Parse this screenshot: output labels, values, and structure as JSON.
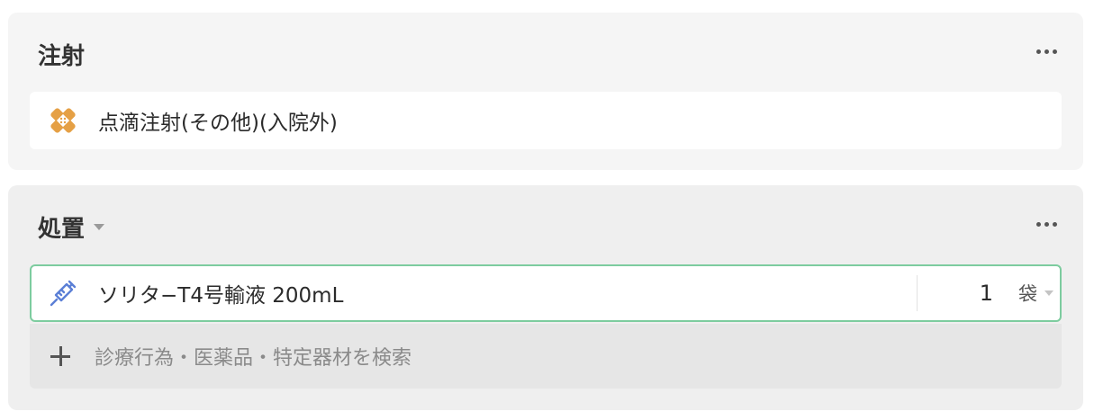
{
  "injection": {
    "title": "注射",
    "more_icon": "more-horizontal-icon",
    "item": {
      "icon": "bandage-cross-icon",
      "label": "点滴注射(その他)(入院外)",
      "icon_color": "#e5a045"
    }
  },
  "procedure": {
    "title": "処置",
    "more_icon": "more-horizontal-icon",
    "drug": {
      "icon": "syringe-icon",
      "label": "ソリタ−T4号輸液 200mL",
      "quantity": "1",
      "unit": "袋",
      "icon_color": "#5b7fd6",
      "border_color": "#7dcc9f"
    },
    "search": {
      "icon": "plus-icon",
      "placeholder": "診療行為・医薬品・特定器材を検索"
    }
  }
}
